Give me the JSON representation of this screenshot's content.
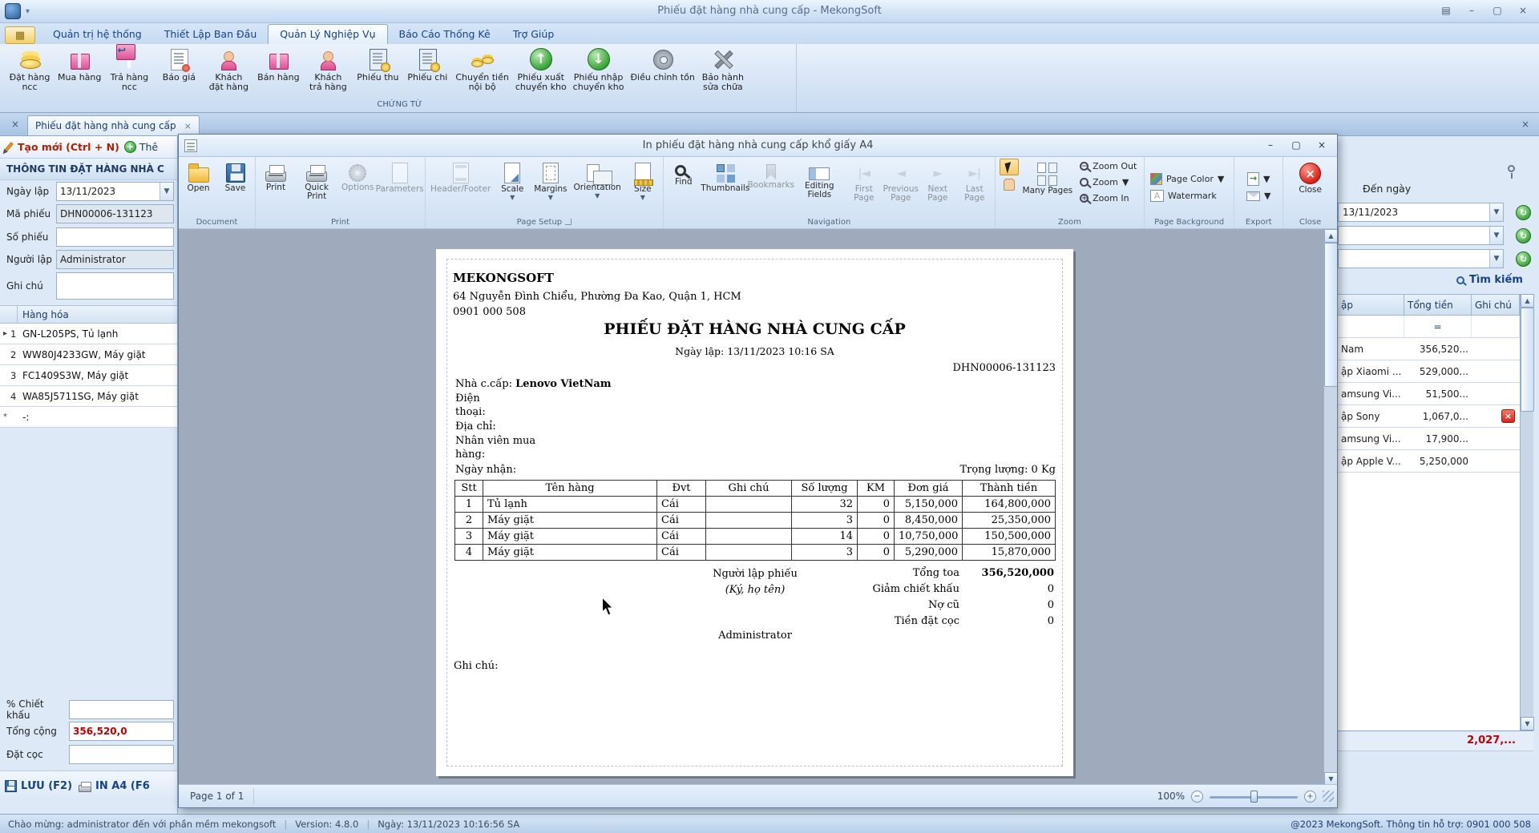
{
  "titlebar": {
    "title": "Phiếu đặt hàng nhà cung cấp - MekongSoft"
  },
  "menubar": {
    "tabs": [
      {
        "label": "Quản trị hệ thống"
      },
      {
        "label": "Thiết Lập Ban Đầu"
      },
      {
        "label": "Quản Lý Nghiệp Vụ"
      },
      {
        "label": "Báo Cáo Thống Kê"
      },
      {
        "label": "Trợ Giúp"
      }
    ]
  },
  "ribbon": {
    "group_label": "CHỨNG TỪ",
    "items": [
      {
        "label": "Đặt hàng\nncc",
        "icon": "supplier-order-icon"
      },
      {
        "label": "Mua hàng",
        "icon": "purchase-icon"
      },
      {
        "label": "Trả hàng\nncc",
        "icon": "return-supplier-icon"
      },
      {
        "label": "Báo giá",
        "icon": "quotation-icon"
      },
      {
        "label": "Khách\nđặt hàng",
        "icon": "customer-order-icon"
      },
      {
        "label": "Bán hàng",
        "icon": "sales-icon"
      },
      {
        "label": "Khách\ntrả hàng",
        "icon": "customer-return-icon"
      },
      {
        "label": "Phiếu thu",
        "icon": "receipt-icon"
      },
      {
        "label": "Phiếu chi",
        "icon": "payment-icon"
      },
      {
        "label": "Chuyển tiền\nnội bộ",
        "icon": "internal-transfer-icon"
      },
      {
        "label": "Phiếu xuất\nchuyển kho",
        "icon": "warehouse-out-icon"
      },
      {
        "label": "Phiếu nhập\nchuyển kho",
        "icon": "warehouse-in-icon"
      },
      {
        "label": "Điều chỉnh tồn",
        "icon": "stock-adjust-icon"
      },
      {
        "label": "Bảo hành\nsửa chữa",
        "icon": "repair-icon"
      }
    ]
  },
  "tabstrip": {
    "active_tab": "Phiếu đặt hàng nhà cung cấp"
  },
  "left_panel": {
    "new_button": "Tạo mới (Ctrl + N)",
    "add_button": "Thê",
    "header": "THÔNG TIN ĐẶT HÀNG NHÀ C",
    "ngay_lap_label": "Ngày lập",
    "ngay_lap_value": "13/11/2023",
    "ma_phieu_label": "Mã phiếu",
    "ma_phieu_value": "DHN00006-131123",
    "so_phieu_label": "Số phiếu",
    "so_phieu_value": "",
    "nguoi_lap_label": "Người lập",
    "nguoi_lap_value": "Administrator",
    "ghi_chu_label": "Ghi chú",
    "ghi_chu_value": "",
    "grid_header": "Hàng hóa",
    "grid_rows": [
      {
        "marker": "▸",
        "num": "1",
        "text": "GN-L205PS, Tủ lạnh"
      },
      {
        "marker": "",
        "num": "2",
        "text": "WW80J4233GW, Máy giặt"
      },
      {
        "marker": "",
        "num": "3",
        "text": "FC1409S3W, Máy giặt"
      },
      {
        "marker": "",
        "num": "4",
        "text": "WA85J5711SG, Máy giặt"
      },
      {
        "marker": "*",
        "num": "",
        "text": "-:"
      }
    ],
    "chiet_khau_label": "% Chiết khấu",
    "tong_cong_label": "Tổng cộng",
    "tong_cong_value": "356,520,0",
    "dat_coc_label": "Đặt cọc",
    "save_button": "LƯU (F2)",
    "print_button": "IN A4 (F6"
  },
  "dialog": {
    "title": "In phiếu đặt hàng nhà cung cấp khổ giấy A4",
    "toolbar": {
      "open": "Open",
      "save": "Save",
      "print": "Print",
      "quick_print": "Quick Print",
      "options": "Options",
      "parameters": "Parameters",
      "header_footer": "Header/Footer",
      "scale": "Scale",
      "margins": "Margins",
      "orientation": "Orientation",
      "size": "Size",
      "find": "Find",
      "thumbnails": "Thumbnails",
      "bookmarks": "Bookmarks",
      "editing_fields": "Editing Fields",
      "first_page": "First\nPage",
      "previous_page": "Previous\nPage",
      "next_page": "Next\nPage",
      "last_page": "Last\nPage",
      "many_pages": "Many Pages",
      "zoom_out": "Zoom Out",
      "zoom": "Zoom",
      "zoom_in": "Zoom In",
      "page_color": "Page Color",
      "watermark": "Watermark",
      "close": "Close",
      "groups": {
        "document": "Document",
        "print": "Print",
        "page_setup": "Page Setup",
        "navigation": "Navigation",
        "zoom": "Zoom",
        "page_background": "Page Background",
        "export": "Export",
        "close": "Close"
      }
    },
    "document": {
      "company": "MEKONGSOFT",
      "address": "64 Nguyễn Đình Chiểu, Phường Đa Kao, Quận 1, HCM",
      "phone": "0901 000 508",
      "title": "PHIẾU ĐẶT HÀNG NHÀ CUNG CẤP",
      "date_line": "Ngày lập: 13/11/2023  10:16 SA",
      "code": "DHN00006-131123",
      "supplier_label": "Nhà c.cấp:",
      "supplier_name": "Lenovo VietNam",
      "phone_label": "Điện\nthoại:",
      "address_label": "Địa chỉ:",
      "buyer_label": "Nhân viên mua\nhàng:",
      "receive_date_label": "Ngày nhận:",
      "weight": "Trọng lượng: 0 Kg",
      "table_headers": [
        "Stt",
        "Tên hàng",
        "Đvt",
        "Ghi chú",
        "Số lượng",
        "KM",
        "Đơn giá",
        "Thành tiền"
      ],
      "table_rows": [
        [
          "1",
          "Tủ lạnh",
          "Cái",
          "",
          "32",
          "0",
          "5,150,000",
          "164,800,000"
        ],
        [
          "2",
          "Máy giặt",
          "Cái",
          "",
          "3",
          "0",
          "8,450,000",
          "25,350,000"
        ],
        [
          "3",
          "Máy giặt",
          "Cái",
          "",
          "14",
          "0",
          "10,750,000",
          "150,500,000"
        ],
        [
          "4",
          "Máy giặt",
          "Cái",
          "",
          "3",
          "0",
          "5,290,000",
          "15,870,000"
        ]
      ],
      "signer_title": "Người lập phiếu",
      "signer_note": "(Ký, họ tên)",
      "totals": [
        {
          "label": "Tổng toa",
          "value": "356,520,000"
        },
        {
          "label": "Giảm chiết khấu",
          "value": "0"
        },
        {
          "label": "Nợ cũ",
          "value": "0"
        },
        {
          "label": "Tiền đặt cọc",
          "value": "0"
        }
      ],
      "signer_name": "Administrator",
      "notes_label": "Ghi chú:"
    },
    "statusbar": {
      "page_info": "Page 1 of 1",
      "zoom_level": "100%"
    }
  },
  "right_panel": {
    "den_ngay_label": "Đến ngày",
    "den_ngay_value": "13/11/2023",
    "search_button": "Tìm kiếm",
    "grid_headers": [
      "ập",
      "Tổng tiền",
      "Ghi chú"
    ],
    "filter_operator": "=",
    "rows": [
      {
        "name": "Nam",
        "total": "356,520..."
      },
      {
        "name": "ập Xiaomi ...",
        "total": "529,000..."
      },
      {
        "name": "amsung Vi...",
        "total": "51,500..."
      },
      {
        "name": "ập Sony",
        "total": "1,067,0..."
      },
      {
        "name": "amsung Vi...",
        "total": "17,900..."
      },
      {
        "name": "ập Apple V...",
        "total": "5,250,000"
      }
    ],
    "footer_total": "2,027,..."
  },
  "statusbar": {
    "welcome": "Chào mừng: administrator đến với phần mềm mekongsoft",
    "version": "Version: 4.8.0",
    "date": "Ngày: 13/11/2023 10:16:56 SA",
    "copyright": "@2023 MekongSoft. Thông tin hỗ trợ: 0901 000 508"
  },
  "colors": {
    "accent_blue": "#15428b",
    "alert_red": "#c00000",
    "success_green": "#2e9e2e"
  }
}
